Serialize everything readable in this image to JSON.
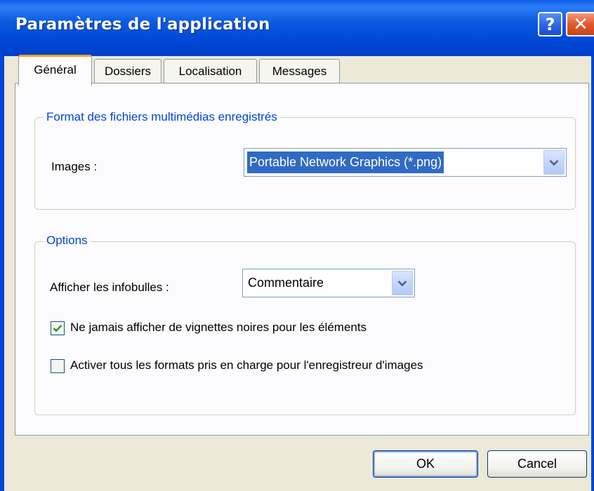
{
  "window": {
    "title": "Paramètres de l'application"
  },
  "title_buttons": {
    "help": "?",
    "close": "✕"
  },
  "tabs": [
    {
      "label": "Général",
      "active": true
    },
    {
      "label": "Dossiers",
      "active": false
    },
    {
      "label": "Localisation",
      "active": false
    },
    {
      "label": "Messages",
      "active": false
    }
  ],
  "media_group": {
    "legend": "Format des fichiers multimédias enregistrés",
    "images_label": "Images :",
    "images_value": "Portable Network Graphics (*.png)"
  },
  "options_group": {
    "legend": "Options",
    "tooltips_label": "Afficher les infobulles :",
    "tooltips_value": "Commentaire",
    "checkbox_thumbnails": {
      "label": "Ne jamais afficher de vignettes noires pour les éléments",
      "checked": true
    },
    "checkbox_formats": {
      "label": "Activer tous les formats pris en charge pour l'enregistreur d'images",
      "checked": false
    }
  },
  "buttons": {
    "ok": "OK",
    "cancel": "Cancel"
  },
  "colors": {
    "title_bar": "#0046d5",
    "dialog_bg": "#ece9d8",
    "legend": "#0046d5",
    "selection": "#316ac5",
    "active_tab_accent": "#f5a623"
  }
}
